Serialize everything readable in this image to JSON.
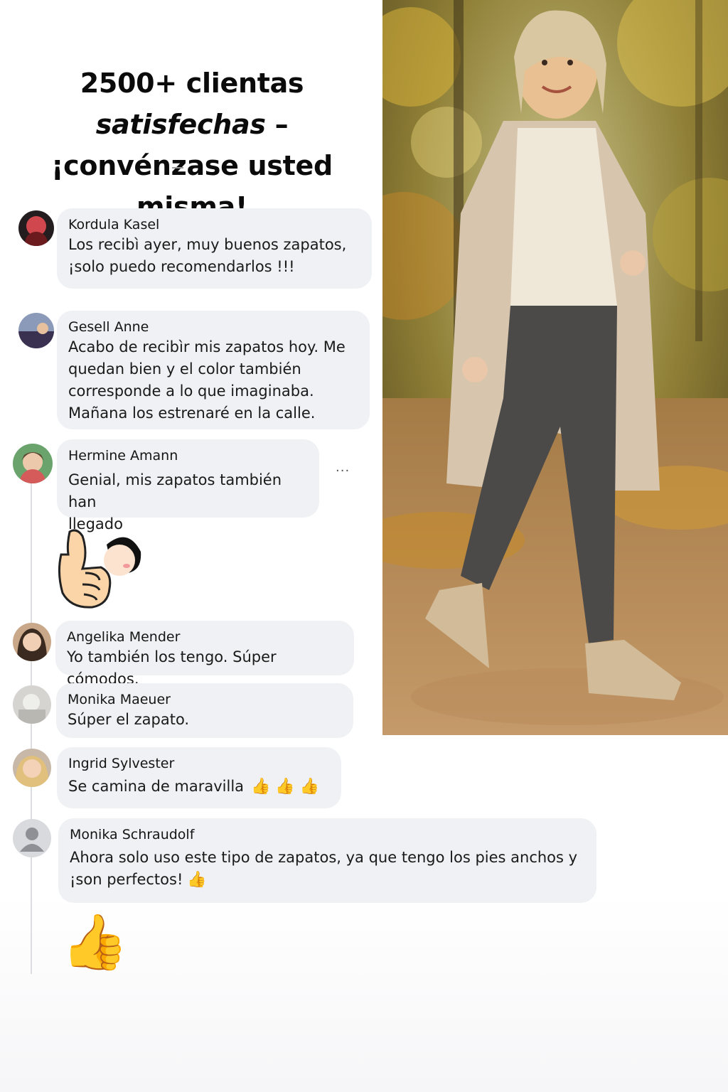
{
  "headline": {
    "line1_before": "2500+ clientas ",
    "line1_em": "satisfechas",
    "line1_after": " –",
    "line2": "¡convénzase usted misma!"
  },
  "photo": {
    "description_icon": "woman-walking-photo"
  },
  "comments": [
    {
      "name": "Kordula Kasel",
      "lines": [
        "Los recibì ayer, muy buenos zapatos,",
        "¡solo puedo recomendarlos !!!"
      ]
    },
    {
      "name": "Gesell Anne",
      "lines": [
        "Acabo de recibìr mis zapatos hoy. Me",
        "quedan bien y el color también",
        "corresponde a lo que imaginaba.",
        "Mañana los estrenaré en la calle."
      ]
    },
    {
      "name": "Hermine Amann",
      "lines": [
        "Genial, mis zapatos también han",
        "llegado"
      ],
      "more": "···"
    },
    {
      "name": "Angelika Mender",
      "lines": [
        "Yo también los tengo. Súper cómodos."
      ]
    },
    {
      "name": "Monika Maeuer",
      "lines": [
        "Súper el zapato."
      ]
    },
    {
      "name": "Ingrid Sylvester",
      "lines": [
        "Se camina de maravilla"
      ],
      "emoji": "👍 👍 👍"
    },
    {
      "name": "Monika Schraudolf",
      "lines": [
        "Ahora solo uso este tipo de zapatos, ya que tengo los pies anchos y",
        "¡son perfectos!"
      ],
      "emoji": "👍"
    }
  ],
  "stickers": {
    "big_thumb": "👍"
  },
  "colors": {
    "bubble": "#f0f1f4",
    "line": "#dcdde1",
    "accent_thumb": "#f5b800"
  }
}
